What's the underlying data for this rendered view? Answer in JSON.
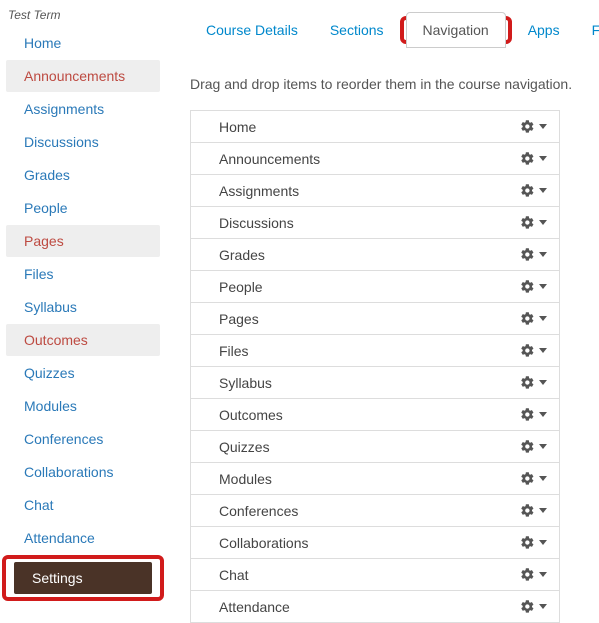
{
  "sidebar": {
    "term": "Test Term",
    "items": [
      {
        "label": "Home",
        "state": "normal"
      },
      {
        "label": "Announcements",
        "state": "disabled"
      },
      {
        "label": "Assignments",
        "state": "normal"
      },
      {
        "label": "Discussions",
        "state": "normal"
      },
      {
        "label": "Grades",
        "state": "normal"
      },
      {
        "label": "People",
        "state": "normal"
      },
      {
        "label": "Pages",
        "state": "disabled"
      },
      {
        "label": "Files",
        "state": "normal"
      },
      {
        "label": "Syllabus",
        "state": "normal"
      },
      {
        "label": "Outcomes",
        "state": "disabled"
      },
      {
        "label": "Quizzes",
        "state": "normal"
      },
      {
        "label": "Modules",
        "state": "normal"
      },
      {
        "label": "Conferences",
        "state": "normal"
      },
      {
        "label": "Collaborations",
        "state": "normal"
      },
      {
        "label": "Chat",
        "state": "normal"
      },
      {
        "label": "Attendance",
        "state": "normal"
      },
      {
        "label": "Settings",
        "state": "selected"
      }
    ]
  },
  "tabs": {
    "items": [
      {
        "label": "Course Details"
      },
      {
        "label": "Sections"
      },
      {
        "label": "Navigation",
        "active": true
      },
      {
        "label": "Apps"
      },
      {
        "label": "Feature Options",
        "cut": true
      }
    ]
  },
  "main": {
    "instruction": "Drag and drop items to reorder them in the course navigation.",
    "nav_items": [
      {
        "label": "Home"
      },
      {
        "label": "Announcements"
      },
      {
        "label": "Assignments"
      },
      {
        "label": "Discussions"
      },
      {
        "label": "Grades"
      },
      {
        "label": "People"
      },
      {
        "label": "Pages"
      },
      {
        "label": "Files"
      },
      {
        "label": "Syllabus"
      },
      {
        "label": "Outcomes"
      },
      {
        "label": "Quizzes"
      },
      {
        "label": "Modules"
      },
      {
        "label": "Conferences"
      },
      {
        "label": "Collaborations"
      },
      {
        "label": "Chat"
      },
      {
        "label": "Attendance"
      }
    ]
  }
}
